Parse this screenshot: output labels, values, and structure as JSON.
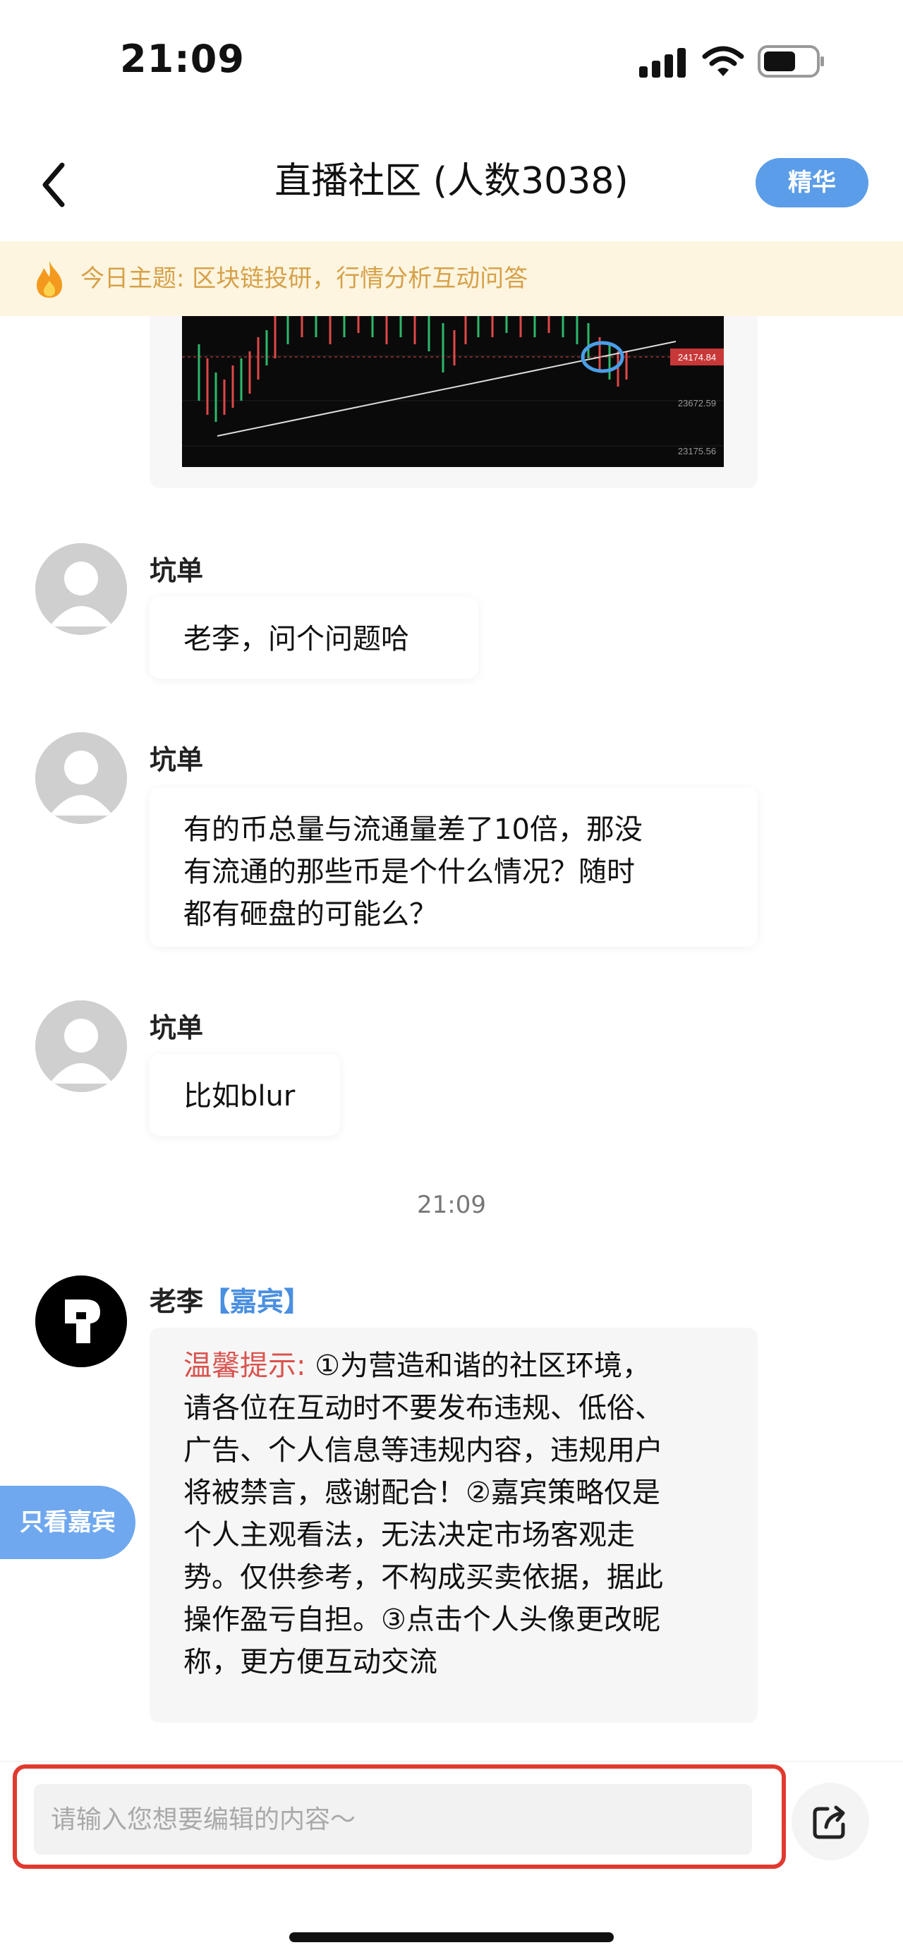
{
  "status_bar": {
    "time": "21:09",
    "icons": [
      "signal-icon",
      "wifi-icon",
      "battery-icon"
    ]
  },
  "header": {
    "back_icon": "chevron-left-icon",
    "title": "直播社区 (人数3038)",
    "essence_button": "精华"
  },
  "topic_bar": {
    "icon": "fire-icon",
    "text": "今日主题: 区块链投研，行情分析互动问答"
  },
  "chat": {
    "image_message": {
      "chart_price_labels": [
        "24174.84",
        "23672.59",
        "23175.56"
      ]
    },
    "messages": [
      {
        "sender": "坑单",
        "text": "老李，问个问题哈"
      },
      {
        "sender": "坑单",
        "lines": [
          "有的币总量与流通量差了10倍，那没",
          "有流通的那些币是个什么情况？随时",
          "都有砸盘的可能么？"
        ]
      },
      {
        "sender": "坑单",
        "text": "比如blur"
      }
    ],
    "time_separator": "21:09",
    "host_message": {
      "sender": "老李",
      "tag": "【嘉宾】",
      "notice_label": "温馨提示:",
      "lines": [
        " ①为营造和谐的社区环境，",
        "请各位在互动时不要发布违规、低俗、",
        "广告、个人信息等违规内容，违规用户",
        "将被禁言，感谢配合！②嘉宾策略仅是",
        "个人主观看法，无法决定市场客观走",
        "势。仅供参考，不构成买卖依据，据此",
        "操作盈亏自担。③点击个人头像更改昵",
        "称，更方便互动交流"
      ]
    },
    "only_guest_button": "只看嘉宾"
  },
  "input": {
    "placeholder": "请输入您想要编辑的内容～",
    "value": "",
    "share_icon": "share-icon"
  },
  "colors": {
    "accent_blue": "#5b9de8",
    "topic_bg": "#fdf5df",
    "topic_text": "#d6a14a",
    "notice_red": "#d9534f",
    "highlight_red": "#e03a2f"
  }
}
